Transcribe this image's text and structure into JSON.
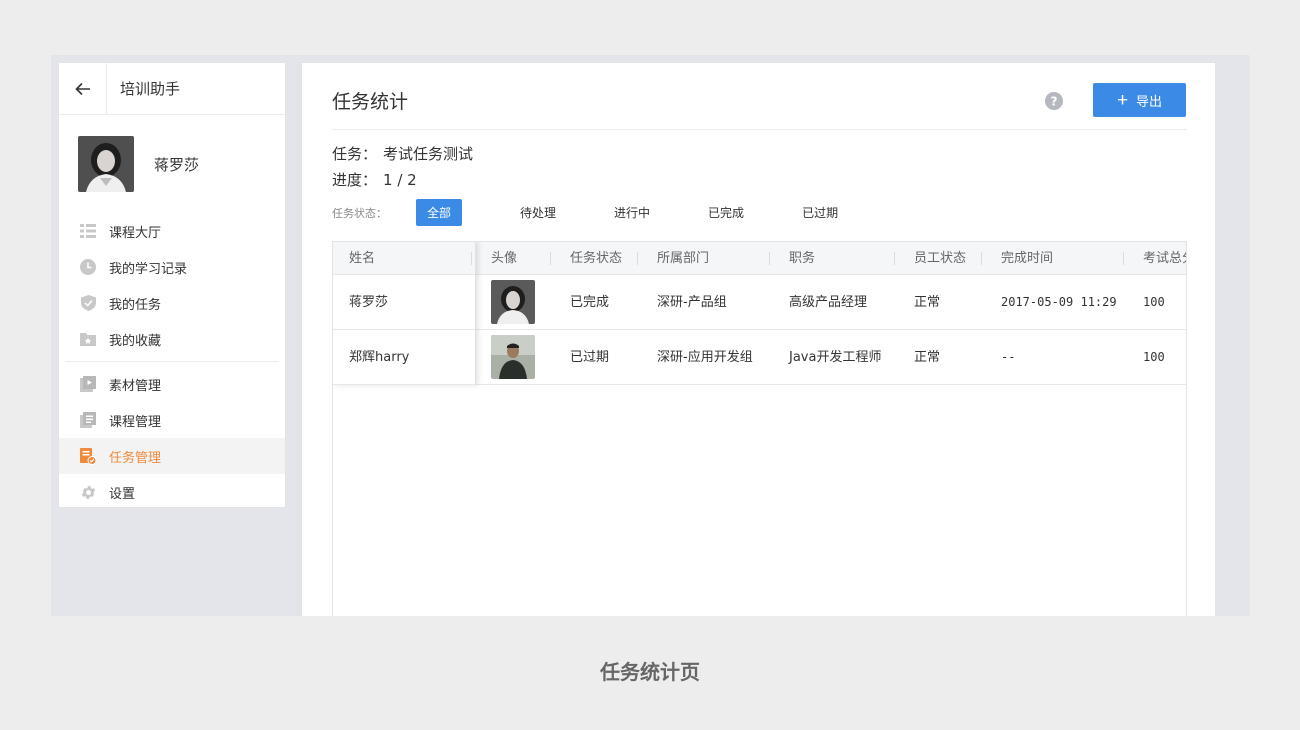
{
  "sidebar": {
    "title": "培训助手",
    "user_name": "蒋罗莎",
    "menu_group1": [
      {
        "label": "课程大厅",
        "icon": "list-icon"
      },
      {
        "label": "我的学习记录",
        "icon": "clock-icon"
      },
      {
        "label": "我的任务",
        "icon": "shield-check-icon"
      },
      {
        "label": "我的收藏",
        "icon": "star-folder-icon"
      }
    ],
    "menu_group2": [
      {
        "label": "素材管理",
        "icon": "play-media-icon"
      },
      {
        "label": "课程管理",
        "icon": "document-icon"
      },
      {
        "label": "任务管理",
        "icon": "task-doc-icon",
        "active": true
      },
      {
        "label": "设置",
        "icon": "gear-icon"
      }
    ]
  },
  "main": {
    "title": "任务统计",
    "export_label": "导出",
    "task_label": "任务：",
    "task_value": "考试任务测试",
    "progress_label": "进度：",
    "progress_value": "1 / 2",
    "filter_label": "任务状态：",
    "filters": [
      "全部",
      "待处理",
      "进行中",
      "已完成",
      "已过期"
    ],
    "active_filter": "全部"
  },
  "table": {
    "columns": [
      "姓名",
      "头像",
      "任务状态",
      "所属部门",
      "职务",
      "员工状态",
      "完成时间",
      "考试总分"
    ],
    "rows": [
      {
        "name": "蒋罗莎",
        "status": "已完成",
        "dept": "深研-产品组",
        "position": "高级产品经理",
        "emp_status": "正常",
        "finish_time": "2017-05-09 11:29",
        "score": "100"
      },
      {
        "name": "郑辉harry",
        "status": "已过期",
        "dept": "深研-应用开发组",
        "position": "Java开发工程师",
        "emp_status": "正常",
        "finish_time": "--",
        "score": "100"
      }
    ]
  },
  "caption": "任务统计页",
  "colors": {
    "accent": "#3b8be6",
    "active_menu": "#f08a3c"
  }
}
